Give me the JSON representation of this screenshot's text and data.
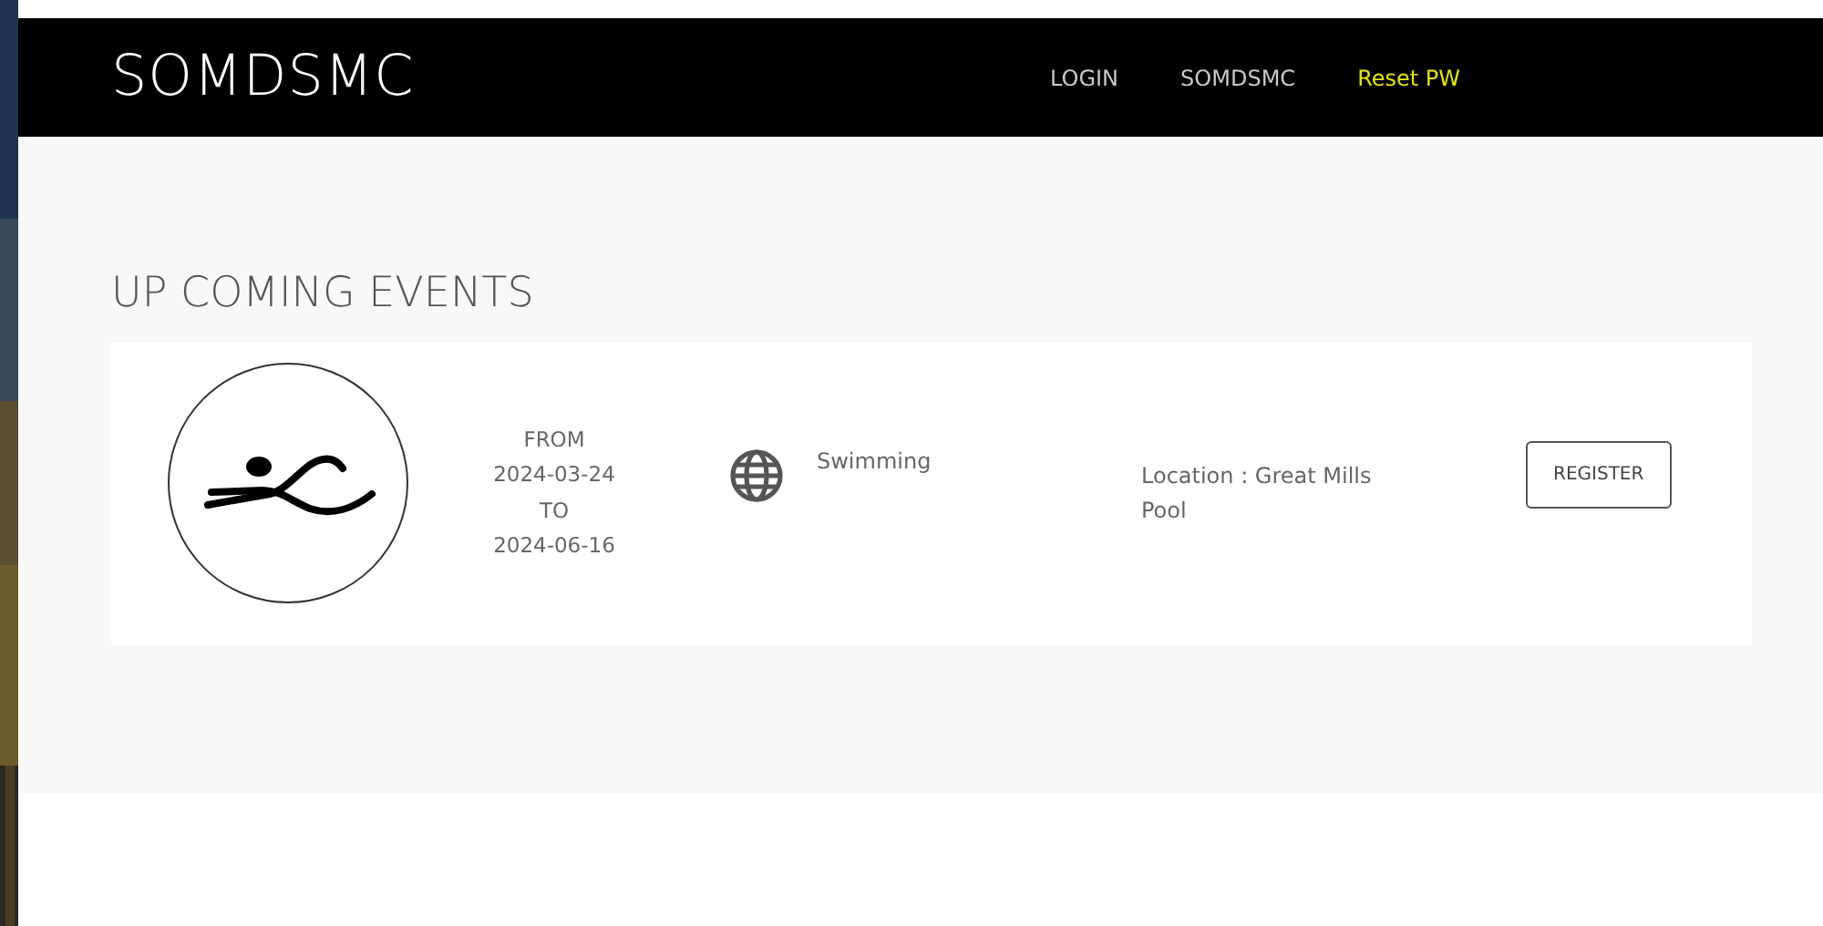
{
  "navbar": {
    "brand": "SOMDSMC",
    "links": [
      {
        "label": "LOGIN",
        "selected": false
      },
      {
        "label": "SOMDSMC",
        "selected": false
      },
      {
        "label": "Reset PW",
        "selected": true
      }
    ]
  },
  "section": {
    "title": "UP COMING EVENTS"
  },
  "events": [
    {
      "from_label": "FROM",
      "from_date": "2024-03-24",
      "to_label": "TO",
      "to_date": "2024-06-16",
      "sport": "Swimming",
      "location": "Location : Great Mills Pool",
      "button": "REGISTER"
    }
  ]
}
